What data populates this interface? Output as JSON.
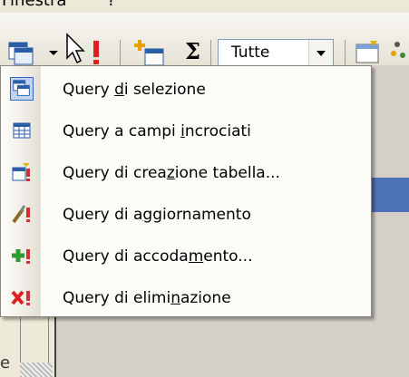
{
  "menubar": {
    "item1": "Finestra",
    "item2": "?"
  },
  "toolbar": {
    "filter_value": "Tutte",
    "sigma": "Σ",
    "icons": [
      "query-type-icon",
      "dropdown-arrow-icon",
      "run-exclamation-icon",
      "show-table-icon",
      "totals-sigma-icon",
      "properties-icon",
      "build-icon"
    ]
  },
  "menu": {
    "items": [
      {
        "pre": "Query ",
        "u": "d",
        "post": "i selezione",
        "icon": "select-query-icon"
      },
      {
        "pre": "Query a campi ",
        "u": "i",
        "post": "ncrociati",
        "icon": "crosstab-query-icon"
      },
      {
        "pre": "Query di crea",
        "u": "z",
        "post": "ione tabella...",
        "icon": "make-table-query-icon"
      },
      {
        "pre": "Query di a",
        "u": "g",
        "post": "giornamento",
        "icon": "update-query-icon"
      },
      {
        "pre": "Query di accoda",
        "u": "m",
        "post": "ento...",
        "icon": "append-query-icon"
      },
      {
        "pre": "Query di elimi",
        "u": "n",
        "post": "azione",
        "icon": "delete-query-icon"
      }
    ]
  },
  "background": {
    "bottom_char": "e"
  },
  "colors": {
    "menu_bg": "#fcfcf9",
    "highlight": "#c1d2ee",
    "highlight_border": "#316ac5"
  }
}
